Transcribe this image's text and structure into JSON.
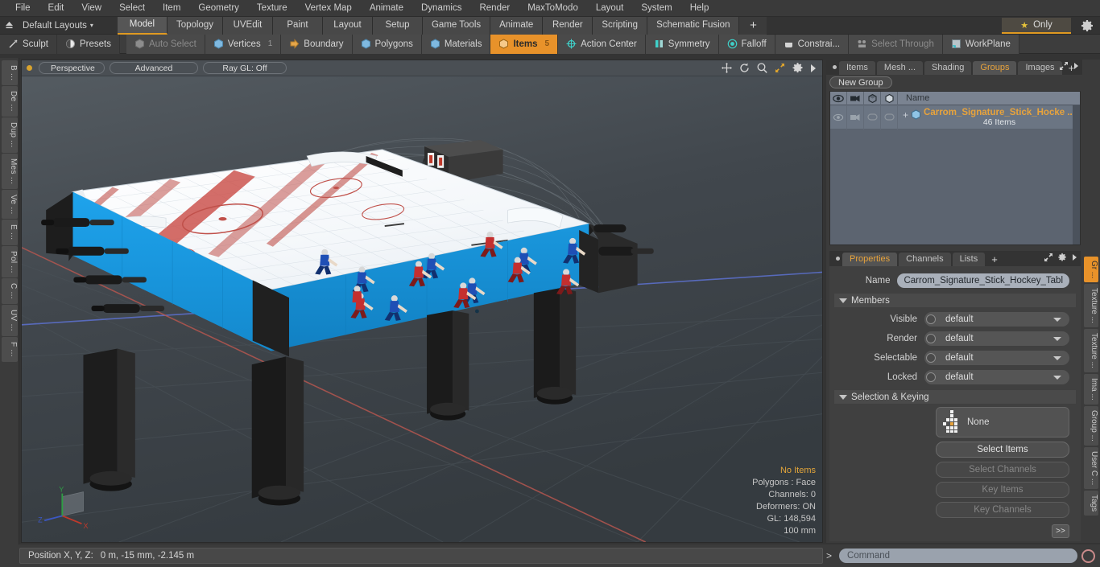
{
  "app": {
    "title": "Modo"
  },
  "menubar": {
    "items": [
      "File",
      "Edit",
      "View",
      "Select",
      "Item",
      "Geometry",
      "Texture",
      "Vertex Map",
      "Animate",
      "Dynamics",
      "Render",
      "MaxToModo",
      "Layout",
      "System",
      "Help"
    ]
  },
  "layoutbar": {
    "layout_label": "Default Layouts",
    "caret": "▾",
    "tabs": [
      {
        "label": "Model",
        "active": true
      },
      {
        "label": "Topology",
        "active": false
      },
      {
        "label": "UVEdit",
        "active": false
      },
      {
        "label": "Paint",
        "active": false
      },
      {
        "label": "Layout",
        "active": false
      },
      {
        "label": "Setup",
        "active": false
      },
      {
        "label": "Game Tools",
        "active": false
      },
      {
        "label": "Animate",
        "active": false
      },
      {
        "label": "Render",
        "active": false
      },
      {
        "label": "Scripting",
        "active": false
      },
      {
        "label": "Schematic Fusion",
        "active": false
      }
    ],
    "add_tab": "+",
    "only_label": "Only",
    "star_icon": "star-icon",
    "gear_icon": "gear-icon"
  },
  "toolbar": {
    "left": [
      {
        "label": "Sculpt",
        "icon": "sculpt-icon",
        "state": "plain"
      },
      {
        "label": "Presets",
        "icon": "presets-icon",
        "state": "plain"
      }
    ],
    "selection_modes": [
      {
        "label": "Auto Select",
        "icon": "cube-grey-icon",
        "state": "dim",
        "count": ""
      },
      {
        "label": "Vertices",
        "icon": "cube-blue-icon",
        "state": "normal",
        "count": "1"
      },
      {
        "label": "Boundary",
        "icon": "boundary-icon",
        "state": "normal",
        "count": ""
      },
      {
        "label": "Polygons",
        "icon": "cube-blue-icon",
        "state": "normal",
        "count": ""
      },
      {
        "label": "Materials",
        "icon": "cube-blue-icon",
        "state": "normal",
        "count": ""
      },
      {
        "label": "Items",
        "icon": "cube-orange-icon",
        "state": "active",
        "count": "5"
      }
    ],
    "right": [
      {
        "label": "Action Center",
        "icon": "target-icon",
        "state": "normal"
      },
      {
        "label": "Symmetry",
        "icon": "symmetry-icon",
        "state": "normal"
      },
      {
        "label": "Falloff",
        "icon": "falloff-icon",
        "state": "normal"
      },
      {
        "label": "Constrai...",
        "icon": "constraint-icon",
        "state": "normal"
      },
      {
        "label": "Select Through",
        "icon": "select-through-icon",
        "state": "dim"
      },
      {
        "label": "WorkPlane",
        "icon": "workplane-icon",
        "state": "normal"
      }
    ]
  },
  "left_rail": {
    "tabs": [
      "B ...",
      "De ...",
      "Dup ...",
      "Mes ...",
      "Ve ...",
      "E ...",
      "Pol ...",
      "C ...",
      "UV ...",
      "F ..."
    ]
  },
  "viewport": {
    "pills": [
      "Perspective",
      "Advanced",
      "Ray GL: Off"
    ],
    "nav_icons": [
      "pan-icon",
      "rotate-icon",
      "zoom-icon",
      "fit-icon",
      "gear-icon",
      "chevron-right-icon"
    ],
    "stats": [
      {
        "text": "No Items",
        "highlight": true
      },
      {
        "text": "Polygons : Face",
        "highlight": false
      },
      {
        "text": "Channels: 0",
        "highlight": false
      },
      {
        "text": "Deformers: ON",
        "highlight": false
      },
      {
        "text": "GL: 148,594",
        "highlight": false
      },
      {
        "text": "100 mm",
        "highlight": false
      }
    ],
    "axis_labels": {
      "x": "X",
      "y": "Y",
      "z": "Z"
    }
  },
  "right_panel": {
    "top_tabs": [
      {
        "label": "Items",
        "active": false
      },
      {
        "label": "Mesh ...",
        "active": false
      },
      {
        "label": "Shading",
        "active": false
      },
      {
        "label": "Groups",
        "active": true
      },
      {
        "label": "Images",
        "active": false
      }
    ],
    "top_tabs_plus": "+",
    "new_group_label": "New Group",
    "group_list": {
      "columns": [
        "eye-icon",
        "render-cam-icon",
        "shaded-cube-icon",
        "solid-cube-icon"
      ],
      "name_header": "Name",
      "rows": [
        {
          "expand": "+",
          "icon": "group-cube-icon",
          "title": "Carrom_Signature_Stick_Hocke ...",
          "subtitle": "46 Items"
        }
      ]
    },
    "prop_tabs": [
      {
        "label": "Properties",
        "active": true
      },
      {
        "label": "Channels",
        "active": false
      },
      {
        "label": "Lists",
        "active": false
      }
    ],
    "prop_tabs_plus": "+",
    "name_label": "Name",
    "name_value": "Carrom_Signature_Stick_Hockey_Tabl",
    "members_section": "Members",
    "member_rows": [
      {
        "label": "Visible",
        "value": "default"
      },
      {
        "label": "Render",
        "value": "default"
      },
      {
        "label": "Selectable",
        "value": "default"
      },
      {
        "label": "Locked",
        "value": "default"
      }
    ],
    "selection_section": "Selection & Keying",
    "none_label": "None",
    "none_icon": "item-list-icon",
    "buttons": [
      {
        "label": "Select Items",
        "enabled": true
      },
      {
        "label": "Select Channels",
        "enabled": false
      },
      {
        "label": "Key Items",
        "enabled": false
      },
      {
        "label": "Key Channels",
        "enabled": false
      }
    ],
    "goto_label": ">>"
  },
  "right_rail": {
    "tabs": [
      {
        "label": "Gr ...",
        "active": true
      },
      {
        "label": "Texture ...",
        "active": false
      },
      {
        "label": "Texture ...",
        "active": false
      },
      {
        "label": "Ima ...",
        "active": false
      },
      {
        "label": "Group ...",
        "active": false
      },
      {
        "label": "User C ...",
        "active": false
      },
      {
        "label": "Tags",
        "active": false
      }
    ]
  },
  "footer": {
    "position_label": "Position X, Y, Z:",
    "position_value": "0 m, -15 mm, -2.145 m",
    "command_prompt": ">",
    "command_placeholder": "Command",
    "record_icon": "record-icon"
  },
  "colors": {
    "accent_orange": "#e8922a",
    "table_blue": "#1b9ae0",
    "panel_bg": "#3b3b3b",
    "viewport_bg": "#3a3f44"
  }
}
